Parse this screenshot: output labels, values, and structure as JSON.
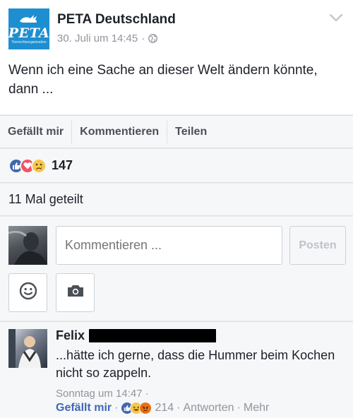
{
  "post": {
    "page_name": "PETA Deutschland",
    "logo_text": "PETA",
    "logo_tagline": "Tierrechtsorganisation",
    "timestamp": "30. Juli um 14:45",
    "meta_separator": "·",
    "text": "Wenn ich eine Sache an dieser Welt ändern könnte, dann ...",
    "icons": {
      "privacy": "globe-icon",
      "menu": "chevron-down-icon",
      "logo_mascot": "rabbit-icon"
    }
  },
  "actions": {
    "like_label": "Gefällt mir",
    "comment_label": "Kommentieren",
    "share_label": "Teilen"
  },
  "reactions": {
    "types": [
      "like",
      "love",
      "sad"
    ],
    "count": "147"
  },
  "shares": {
    "text": "11 Mal geteilt"
  },
  "composer": {
    "placeholder": "Kommentieren ...",
    "post_button": "Posten",
    "icons": {
      "emoji": "smiley-icon",
      "photo": "camera-icon"
    }
  },
  "comment": {
    "author_first_name": "Felix",
    "text": "...hätte ich gerne, dass die Hummer beim Kochen nicht so zappeln.",
    "timestamp": "Sonntag um 14:47",
    "time_separator": "·",
    "like_label": "Gefällt mir",
    "sep": "·",
    "reaction_types": [
      "like",
      "haha",
      "angry"
    ],
    "reaction_count": "214",
    "reply_label": "Antworten",
    "more_label": "Mehr"
  },
  "colors": {
    "facebook_blue": "#4267b2",
    "peta_blue": "#1d8fd0",
    "love_red": "#f25268",
    "emoji_yellow": "#f7c64b",
    "muted_gray": "#90949c"
  }
}
